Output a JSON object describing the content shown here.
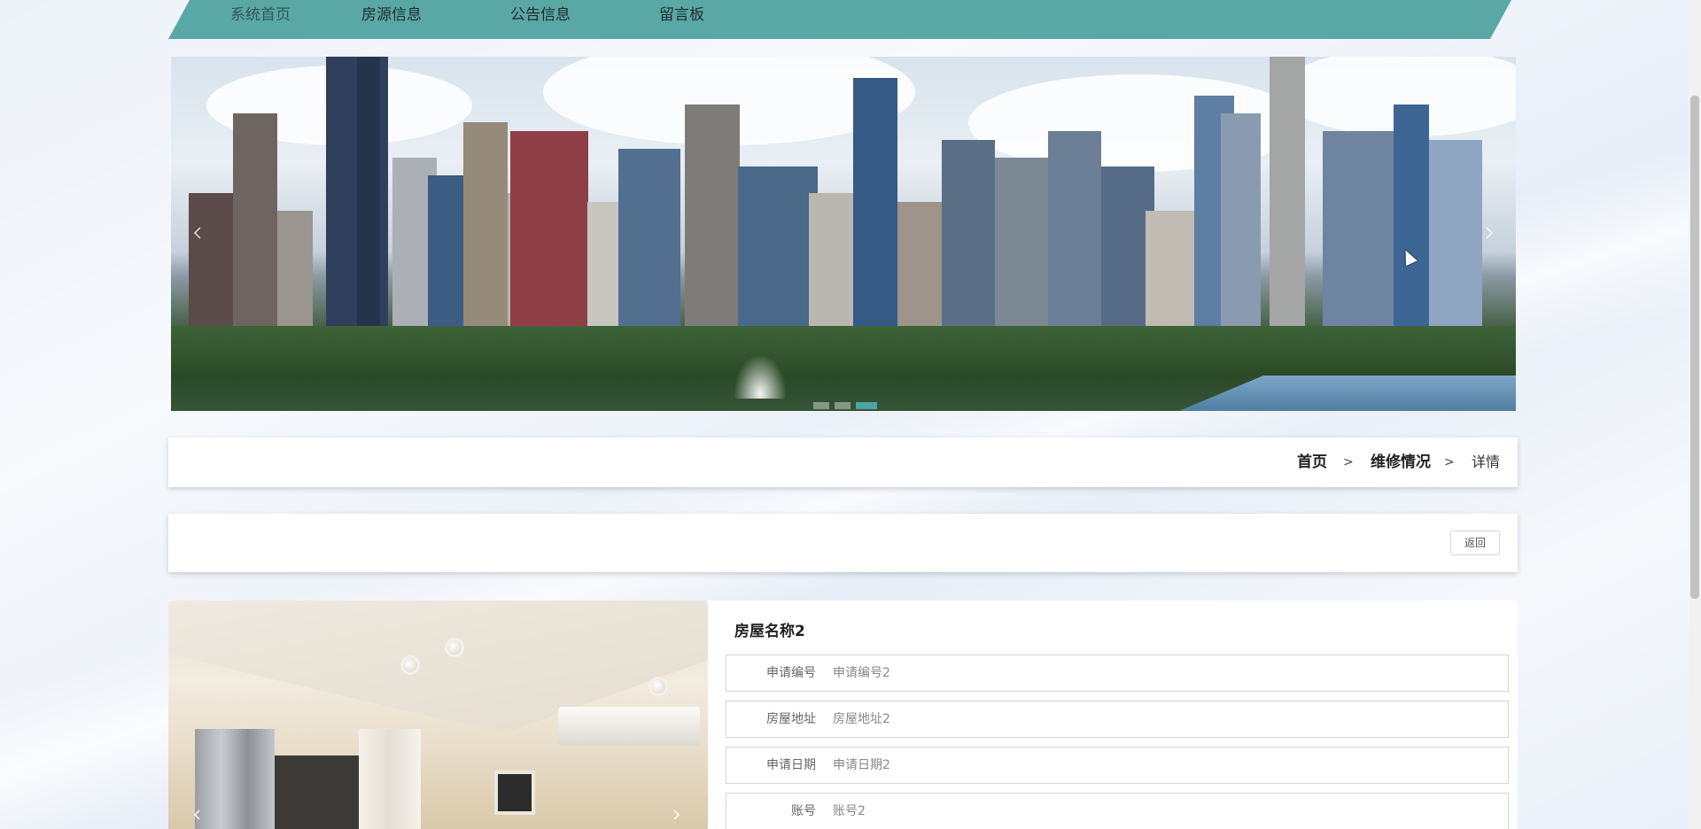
{
  "nav": {
    "items": [
      {
        "label": "系统首页",
        "active": true
      },
      {
        "label": "房源信息",
        "active": false
      },
      {
        "label": "公告信息",
        "active": false
      },
      {
        "label": "留言板",
        "active": false
      }
    ]
  },
  "banner": {
    "prev_icon": "chevron-left-icon",
    "next_icon": "chevron-right-icon",
    "slide_count": 3,
    "active_slide": 3
  },
  "breadcrumb": {
    "home": "首页",
    "section": "维修情况",
    "current": "详情",
    "separator": ">"
  },
  "actions": {
    "back_label": "返回"
  },
  "detail": {
    "title": "房屋名称2",
    "fields": [
      {
        "label": "申请编号",
        "value": "申请编号2"
      },
      {
        "label": "房屋地址",
        "value": "房屋地址2"
      },
      {
        "label": "申请日期",
        "value": "申请日期2"
      },
      {
        "label": "账号",
        "value": "账号2"
      }
    ]
  },
  "colors": {
    "accent": "#5aa8a5",
    "dot_active": "#4fa4a0"
  }
}
